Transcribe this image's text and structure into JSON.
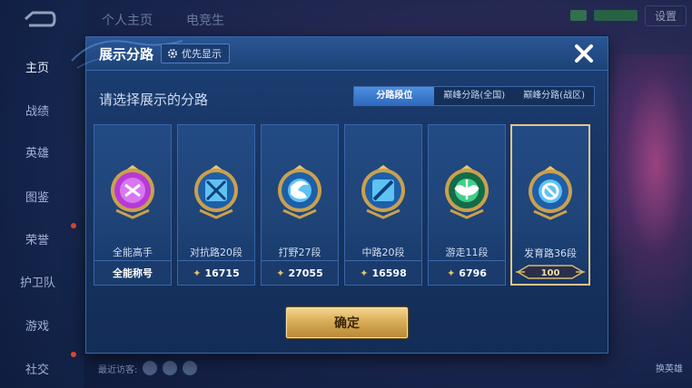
{
  "background": {
    "nav_items": [
      {
        "label": "主页",
        "active": true
      },
      {
        "label": "战绩"
      },
      {
        "label": "英雄"
      },
      {
        "label": "图鉴"
      },
      {
        "label": "荣誉"
      },
      {
        "label": "护卫队"
      },
      {
        "label": "游戏"
      },
      {
        "label": "社交"
      }
    ],
    "top_tabs": [
      "个人主页",
      "电竞生"
    ],
    "settings_label": "设置",
    "recent_visitors": "最近访客:",
    "change_button": "换英雄"
  },
  "modal": {
    "title": "展示分路",
    "priority_button": "优先显示",
    "prompt": "请选择展示的分路",
    "tabs": [
      {
        "label": "分路段位",
        "active": true
      },
      {
        "label": "巅峰分路(全国)"
      },
      {
        "label": "巅峰分路(战区)"
      }
    ],
    "cards": [
      {
        "lane": "全能高手",
        "footer_text": "全能称号",
        "emblem_color": "#b53ad6",
        "emblem_icon": "allround-icon"
      },
      {
        "lane": "对抗路20段",
        "score": "16715",
        "emblem_color": "#2a8fd8",
        "emblem_icon": "clash-lane-icon"
      },
      {
        "lane": "打野27段",
        "score": "27055",
        "emblem_color": "#2a8fd8",
        "emblem_icon": "jungle-icon"
      },
      {
        "lane": "中路20段",
        "score": "16598",
        "emblem_color": "#2a8fd8",
        "emblem_icon": "mid-lane-icon"
      },
      {
        "lane": "游走11段",
        "score": "6796",
        "emblem_color": "#1fa86a",
        "emblem_icon": "roam-icon"
      },
      {
        "lane": "发育路36段",
        "badge": "100",
        "emblem_color": "#2a8fd8",
        "emblem_icon": "farm-lane-icon",
        "selected": true
      }
    ],
    "confirm_button": "确定"
  },
  "colors": {
    "accent_gold": "#e3c487",
    "tab_active": "#3d7fd6",
    "modal_bg": "#173564"
  }
}
